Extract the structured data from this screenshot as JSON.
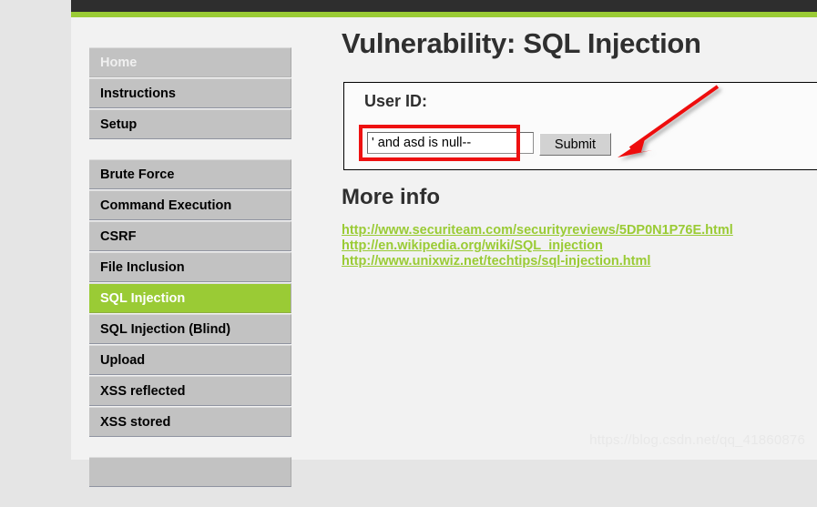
{
  "browser": {
    "top_bar_color": "#2e2e2e",
    "accent_color": "#9acb35"
  },
  "sidebar": {
    "groups": [
      {
        "items": [
          {
            "label": "Home",
            "state": "muted"
          },
          {
            "label": "Instructions",
            "state": "normal"
          },
          {
            "label": "Setup",
            "state": "normal"
          }
        ]
      },
      {
        "items": [
          {
            "label": "Brute Force",
            "state": "normal"
          },
          {
            "label": "Command Execution",
            "state": "normal"
          },
          {
            "label": "CSRF",
            "state": "normal"
          },
          {
            "label": "File Inclusion",
            "state": "normal"
          },
          {
            "label": "SQL Injection",
            "state": "active"
          },
          {
            "label": "SQL Injection (Blind)",
            "state": "normal"
          },
          {
            "label": "Upload",
            "state": "normal"
          },
          {
            "label": "XSS reflected",
            "state": "normal"
          },
          {
            "label": "XSS stored",
            "state": "normal"
          }
        ]
      },
      {
        "items": [
          {
            "label": "",
            "state": "normal"
          }
        ]
      }
    ]
  },
  "main": {
    "page_title": "Vulnerability: SQL Injection",
    "form": {
      "legend": "User ID:",
      "input_value": "' and asd is null--",
      "input_placeholder": "",
      "submit_label": "Submit"
    },
    "more_info": {
      "title": "More info",
      "links": [
        "http://www.securiteam.com/securityreviews/5DP0N1P76E.html",
        "http://en.wikipedia.org/wiki/SQL_injection",
        "http://www.unixwiz.net/techtips/sql-injection.html"
      ]
    }
  },
  "annotations": {
    "highlight_color": "#ee1111",
    "rect_target": "userid-input",
    "arrow_target": "submit-button"
  },
  "watermark": {
    "text": "https://blog.csdn.net/qq_41860876"
  }
}
